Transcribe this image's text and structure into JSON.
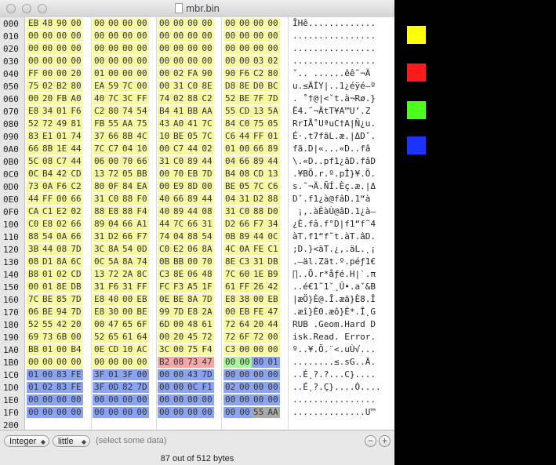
{
  "window": {
    "title": "mbr.bin"
  },
  "colors": {
    "yellow": "#f8f89e",
    "pink": "#f7a6a6",
    "green": "#a8f59a",
    "blue": "#8aa3f2",
    "gray": "#a9a9a9"
  },
  "rows": [
    {
      "addr": "000",
      "bytes": [
        "EB",
        "48",
        "90",
        "00",
        "00",
        "00",
        "00",
        "00",
        "00",
        "00",
        "00",
        "00",
        "00",
        "00",
        "00",
        "00"
      ],
      "ascii": "ÎHê............."
    },
    {
      "addr": "010",
      "bytes": [
        "00",
        "00",
        "00",
        "00",
        "00",
        "00",
        "00",
        "00",
        "00",
        "00",
        "00",
        "00",
        "00",
        "00",
        "00",
        "00"
      ],
      "ascii": "................"
    },
    {
      "addr": "020",
      "bytes": [
        "00",
        "00",
        "00",
        "00",
        "00",
        "00",
        "00",
        "00",
        "00",
        "00",
        "00",
        "00",
        "00",
        "00",
        "00",
        "00"
      ],
      "ascii": "................"
    },
    {
      "addr": "030",
      "bytes": [
        "00",
        "00",
        "00",
        "00",
        "00",
        "00",
        "00",
        "00",
        "00",
        "00",
        "00",
        "00",
        "00",
        "00",
        "03",
        "02"
      ],
      "ascii": "................"
    },
    {
      "addr": "040",
      "bytes": [
        "FF",
        "00",
        "00",
        "20",
        "01",
        "00",
        "00",
        "00",
        "00",
        "02",
        "FA",
        "90",
        "90",
        "F6",
        "C2",
        "80"
      ],
      "ascii": "ˇ.. ......êê˜¬Ä"
    },
    {
      "addr": "050",
      "bytes": [
        "75",
        "02",
        "B2",
        "80",
        "EA",
        "59",
        "7C",
        "00",
        "00",
        "31",
        "C0",
        "8E",
        "D8",
        "8E",
        "D0",
        "BC"
      ],
      "ascii": "u.≤ÄÍY|..1¿éÿé–º"
    },
    {
      "addr": "060",
      "bytes": [
        "00",
        "20",
        "FB",
        "A0",
        "40",
        "7C",
        "3C",
        "FF",
        "74",
        "02",
        "88",
        "C2",
        "52",
        "BE",
        "7F",
        "7D"
      ],
      "ascii": ". ˚†@|<ˇt.à¬Rø.}"
    },
    {
      "addr": "070",
      "bytes": [
        "E8",
        "34",
        "01",
        "F6",
        "C2",
        "80",
        "74",
        "54",
        "B4",
        "41",
        "BB",
        "AA",
        "55",
        "CD",
        "13",
        "5A"
      ],
      "ascii": "Ë4.˜¬ÄtT¥A™U’.Z"
    },
    {
      "addr": "080",
      "bytes": [
        "52",
        "72",
        "49",
        "81",
        "FB",
        "55",
        "AA",
        "75",
        "43",
        "A0",
        "41",
        "7C",
        "84",
        "C0",
        "75",
        "05"
      ],
      "ascii": "RrIÅ˚UªuC†A|Ñ¿u."
    },
    {
      "addr": "090",
      "bytes": [
        "83",
        "E1",
        "01",
        "74",
        "37",
        "66",
        "8B",
        "4C",
        "10",
        "BE",
        "05",
        "7C",
        "C6",
        "44",
        "FF",
        "01"
      ],
      "ascii": "É·.t7fãL.æ.|ΔDˇ."
    },
    {
      "addr": "0A0",
      "bytes": [
        "66",
        "8B",
        "1E",
        "44",
        "7C",
        "C7",
        "04",
        "10",
        "00",
        "C7",
        "44",
        "02",
        "01",
        "00",
        "66",
        "89"
      ],
      "ascii": "fã.D|«...«D..fâ"
    },
    {
      "addr": "0B0",
      "bytes": [
        "5C",
        "08",
        "C7",
        "44",
        "06",
        "00",
        "70",
        "66",
        "31",
        "C0",
        "89",
        "44",
        "04",
        "66",
        "89",
        "44"
      ],
      "ascii": "\\.«D..pf1¿âD.fâD"
    },
    {
      "addr": "0C0",
      "bytes": [
        "0C",
        "B4",
        "42",
        "CD",
        "13",
        "72",
        "05",
        "BB",
        "00",
        "70",
        "EB",
        "7D",
        "B4",
        "08",
        "CD",
        "13"
      ],
      "ascii": ".¥BÕ.r.º.pÎ}¥.Õ."
    },
    {
      "addr": "0D0",
      "bytes": [
        "73",
        "0A",
        "F6",
        "C2",
        "80",
        "0F",
        "84",
        "EA",
        "00",
        "E9",
        "8D",
        "00",
        "BE",
        "05",
        "7C",
        "C6"
      ],
      "ascii": "s.˜¬Ä.ÑÍ.Èç.æ.|Δ"
    },
    {
      "addr": "0E0",
      "bytes": [
        "44",
        "FF",
        "00",
        "66",
        "31",
        "C0",
        "88",
        "F0",
        "40",
        "66",
        "89",
        "44",
        "04",
        "31",
        "D2",
        "88"
      ],
      "ascii": "Dˇ.f1¿à@fâD.1“à"
    },
    {
      "addr": "0F0",
      "bytes": [
        "CA",
        "C1",
        "E2",
        "02",
        "88",
        "E8",
        "88",
        "F4",
        "40",
        "89",
        "44",
        "08",
        "31",
        "C0",
        "88",
        "D0"
      ],
      "ascii": " ¡‚.àÈàÙ@âD.1¿à–"
    },
    {
      "addr": "100",
      "bytes": [
        "C0",
        "E8",
        "02",
        "66",
        "89",
        "04",
        "66",
        "A1",
        "44",
        "7C",
        "66",
        "31",
        "D2",
        "66",
        "F7",
        "34"
      ],
      "ascii": "¿È.fâ.f°D|f1“f˜4"
    },
    {
      "addr": "110",
      "bytes": [
        "88",
        "54",
        "0A",
        "66",
        "31",
        "D2",
        "66",
        "F7",
        "74",
        "04",
        "88",
        "54",
        "0B",
        "89",
        "44",
        "0C"
      ],
      "ascii": "àT.f1“f˜t.àT.âD."
    },
    {
      "addr": "120",
      "bytes": [
        "3B",
        "44",
        "08",
        "7D",
        "3C",
        "8A",
        "54",
        "0D",
        "C0",
        "E2",
        "06",
        "8A",
        "4C",
        "0A",
        "FE",
        "C1"
      ],
      "ascii": ";D.}<äT.¿‚.äL.˛¡"
    },
    {
      "addr": "130",
      "bytes": [
        "08",
        "D1",
        "8A",
        "6C",
        "0C",
        "5A",
        "8A",
        "74",
        "0B",
        "BB",
        "00",
        "70",
        "8E",
        "C3",
        "31",
        "DB"
      ],
      "ascii": ".—äl.Zät.º.péƒ1€"
    },
    {
      "addr": "140",
      "bytes": [
        "B8",
        "01",
        "02",
        "CD",
        "13",
        "72",
        "2A",
        "8C",
        "C3",
        "8E",
        "06",
        "48",
        "7C",
        "60",
        "1E",
        "B9"
      ],
      "ascii": "∏..Õ.r*åƒé.H|`.π"
    },
    {
      "addr": "150",
      "bytes": [
        "00",
        "01",
        "8E",
        "DB",
        "31",
        "F6",
        "31",
        "FF",
        "FC",
        "F3",
        "A5",
        "1F",
        "61",
        "FF",
        "26",
        "42"
      ],
      "ascii": "..é€1˜1ˇ¸Û•.aˇ&B"
    },
    {
      "addr": "160",
      "bytes": [
        "7C",
        "BE",
        "85",
        "7D",
        "E8",
        "40",
        "00",
        "EB",
        "0E",
        "BE",
        "8A",
        "7D",
        "E8",
        "38",
        "00",
        "EB"
      ],
      "ascii": "|æÖ}È@.Î.æä}È8.Î"
    },
    {
      "addr": "170",
      "bytes": [
        "06",
        "BE",
        "94",
        "7D",
        "E8",
        "30",
        "00",
        "BE",
        "99",
        "7D",
        "E8",
        "2A",
        "00",
        "EB",
        "FE",
        "47"
      ],
      "ascii": ".æî}È0.æô}È*.Î˛G"
    },
    {
      "addr": "180",
      "bytes": [
        "52",
        "55",
        "42",
        "20",
        "00",
        "47",
        "65",
        "6F",
        "6D",
        "00",
        "48",
        "61",
        "72",
        "64",
        "20",
        "44"
      ],
      "ascii": "RUB .Geom.Hard D"
    },
    {
      "addr": "190",
      "bytes": [
        "69",
        "73",
        "6B",
        "00",
        "52",
        "65",
        "61",
        "64",
        "00",
        "20",
        "45",
        "72",
        "72",
        "6F",
        "72",
        "00"
      ],
      "ascii": "isk.Read. Error."
    },
    {
      "addr": "1A0",
      "bytes": [
        "BB",
        "01",
        "00",
        "B4",
        "0E",
        "CD",
        "10",
        "AC",
        "3C",
        "00",
        "75",
        "F4",
        "C3",
        "00",
        "00",
        "00"
      ],
      "ascii": "º..¥.Õ.¨<.uÙ√..."
    },
    {
      "addr": "1B0",
      "bytes": [
        "00",
        "00",
        "00",
        "00",
        "00",
        "00",
        "00",
        "00",
        "B2",
        "08",
        "73",
        "47",
        "00",
        "00",
        "80",
        "01"
      ],
      "ascii": "........≤.sG..Ä."
    },
    {
      "addr": "1C0",
      "bytes": [
        "01",
        "00",
        "83",
        "FE",
        "3F",
        "01",
        "3F",
        "00",
        "00",
        "00",
        "43",
        "7D",
        "00",
        "00",
        "00",
        "00"
      ],
      "ascii": "..É˛?.?...C}...."
    },
    {
      "addr": "1D0",
      "bytes": [
        "01",
        "02",
        "83",
        "FE",
        "3F",
        "0D",
        "82",
        "7D",
        "00",
        "00",
        "0C",
        "F1",
        "02",
        "00",
        "00",
        "00"
      ],
      "ascii": "..É˛?.Ç}....Ò...."
    },
    {
      "addr": "1E0",
      "bytes": [
        "00",
        "00",
        "00",
        "00",
        "00",
        "00",
        "00",
        "00",
        "00",
        "00",
        "00",
        "00",
        "00",
        "00",
        "00",
        "00"
      ],
      "ascii": "................"
    },
    {
      "addr": "1F0",
      "bytes": [
        "00",
        "00",
        "00",
        "00",
        "00",
        "00",
        "00",
        "00",
        "00",
        "00",
        "00",
        "00",
        "00",
        "00",
        "55",
        "AA"
      ],
      "ascii": "..............U™"
    },
    {
      "addr": "200",
      "bytes": [],
      "ascii": ""
    }
  ],
  "controls": {
    "type_label": "Integer",
    "endian_label": "little",
    "hint": "(select some data)",
    "remove_symbol": "−",
    "add_symbol": "+"
  },
  "status": {
    "text": "87 out of 512 bytes"
  },
  "legend": [
    {
      "name": "legend-yellow",
      "color": "#ffff00"
    },
    {
      "name": "legend-red",
      "color": "#ff1a1a"
    },
    {
      "name": "legend-green",
      "color": "#4cff1a"
    },
    {
      "name": "legend-blue",
      "color": "#1a33ff"
    }
  ]
}
